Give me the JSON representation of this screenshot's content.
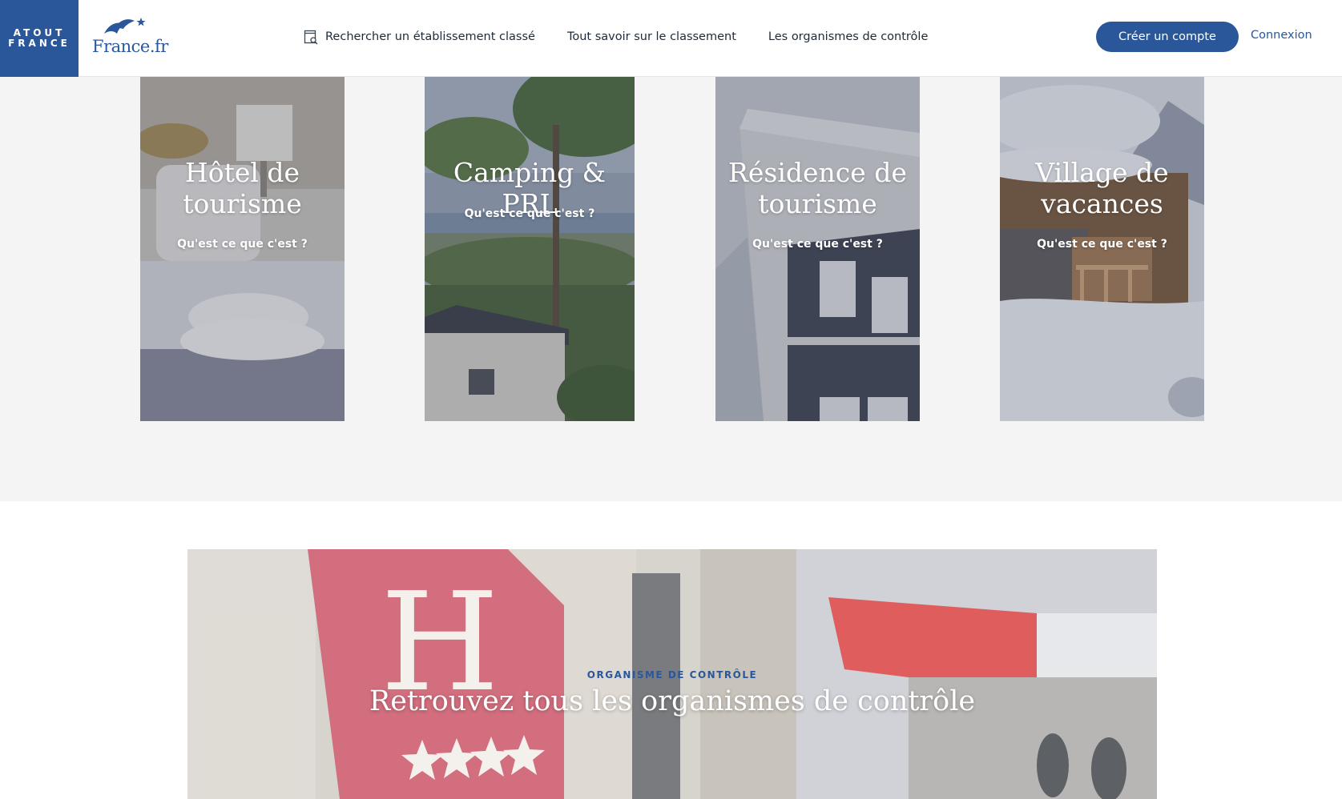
{
  "header": {
    "logo_atout_lines": [
      "ATOUT",
      "FRANCE"
    ],
    "logo_france": "France.fr",
    "nav": [
      {
        "label": "Rechercher un établissement classé",
        "icon": "search-document-icon"
      },
      {
        "label": "Tout savoir sur le classement"
      },
      {
        "label": "Les organismes de contrôle"
      }
    ],
    "create_account_label": "Créer un compte",
    "login_label": "Connexion"
  },
  "cards": [
    {
      "title_lines": [
        "Hôtel de",
        "tourisme"
      ],
      "link": "Qu'est ce que c'est ?"
    },
    {
      "title_lines": [
        "Camping & PRL"
      ],
      "link": "Qu'est ce que c'est ?"
    },
    {
      "title_lines": [
        "Résidence de",
        "tourisme"
      ],
      "link": "Qu'est ce que c'est ?"
    },
    {
      "title_lines": [
        "Village de",
        "vacances"
      ],
      "link": "Qu'est ce que c'est ?"
    }
  ],
  "banner": {
    "eyebrow": "ORGANISME DE CONTRÔLE",
    "headline": "Retrouvez tous les organismes de contrôle",
    "sign_letter": "H"
  },
  "colors": {
    "brand_blue": "#2a5799",
    "section_gray": "#f4f4f4"
  }
}
